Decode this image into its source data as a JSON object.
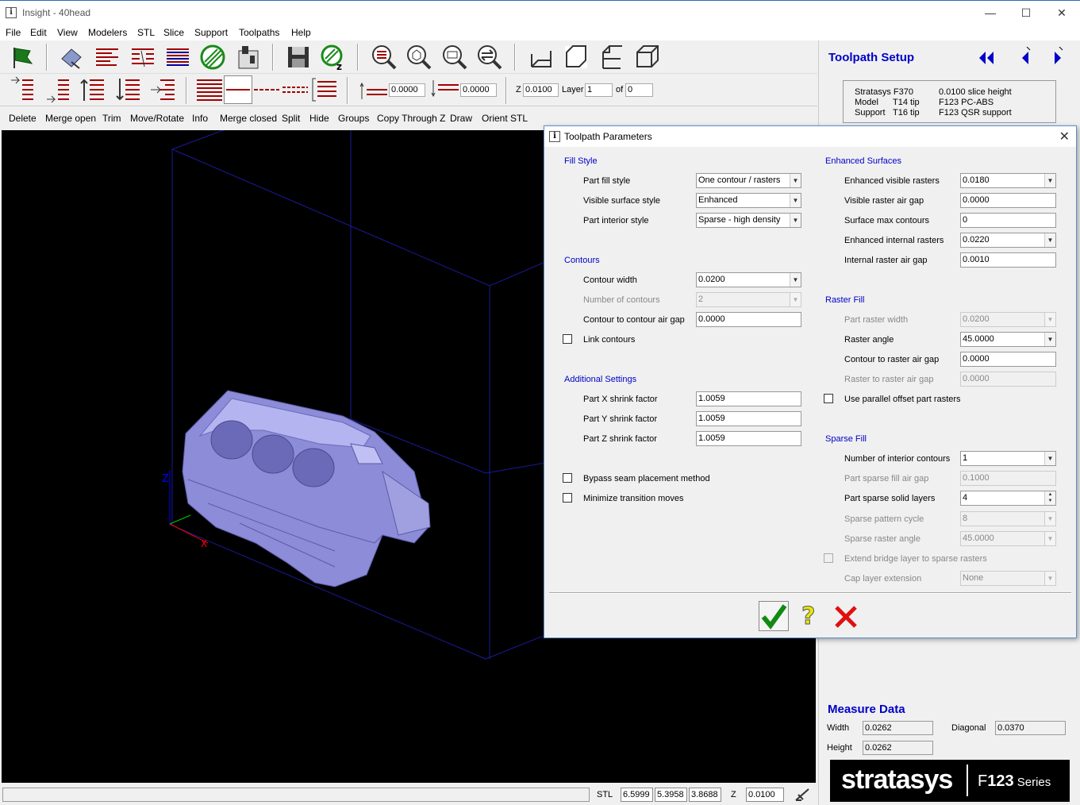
{
  "window": {
    "title": "Insight - 40head"
  },
  "menu": [
    "File",
    "Edit",
    "View",
    "Modelers",
    "STL",
    "Slice",
    "Support",
    "Toolpaths",
    "Help"
  ],
  "toolbar2": {
    "field1": "0.0000",
    "field2": "0.0000",
    "z_label": "Z",
    "z_value": "0.0100",
    "layer_label": "Layer",
    "layer_value": "1",
    "of_label": "of",
    "of_value": "0"
  },
  "commands": [
    "Delete",
    "Merge open",
    "Trim",
    "Move/Rotate",
    "Info",
    "Merge closed",
    "Split",
    "Hide",
    "Groups",
    "Copy Through Z",
    "Draw",
    "Orient STL"
  ],
  "right_panel": {
    "title": "Toolpath Setup",
    "machine": [
      [
        "Stratasys F370",
        "0.0100 slice height"
      ],
      [
        "Model",
        "T14 tip",
        "F123 PC-ABS"
      ],
      [
        "Support",
        "T16 tip",
        "F123 QSR support"
      ]
    ],
    "measure_title": "Measure Data",
    "width_label": "Width",
    "width": "0.0262",
    "height_label": "Height",
    "height": "0.0262",
    "diagonal_label": "Diagonal",
    "diagonal": "0.0370",
    "logo_main": "stratasys",
    "logo_sub1": "F",
    "logo_sub2": "123",
    "logo_sub3": " Series"
  },
  "status": {
    "stl_label": "STL",
    "x": "6.5999",
    "y": "5.3958",
    "zsize": "3.8688",
    "z_label": "Z",
    "z": "0.0100"
  },
  "viewport": {
    "axis_z": "Z",
    "axis_x": "X"
  },
  "dialog": {
    "title": "Toolpath Parameters",
    "fill_style": {
      "heading": "Fill Style",
      "part_fill_style_label": "Part fill style",
      "part_fill_style": "One contour / rasters",
      "visible_surface_style_label": "Visible surface style",
      "visible_surface_style": "Enhanced",
      "part_interior_style_label": "Part interior style",
      "part_interior_style": "Sparse - high density"
    },
    "contours": {
      "heading": "Contours",
      "contour_width_label": "Contour width",
      "contour_width": "0.0200",
      "number_of_contours_label": "Number of contours",
      "number_of_contours": "2",
      "contour_air_gap_label": "Contour to contour air gap",
      "contour_air_gap": "0.0000",
      "link_contours_label": "Link contours"
    },
    "additional": {
      "heading": "Additional Settings",
      "x_shrink_label": "Part X shrink factor",
      "x_shrink": "1.0059",
      "y_shrink_label": "Part Y shrink factor",
      "y_shrink": "1.0059",
      "z_shrink_label": "Part Z shrink factor",
      "z_shrink": "1.0059",
      "bypass_seam_label": "Bypass seam placement method",
      "minimize_transition_label": "Minimize transition moves"
    },
    "enhanced": {
      "heading": "Enhanced Surfaces",
      "visible_rasters_label": "Enhanced visible rasters",
      "visible_rasters": "0.0180",
      "visible_air_gap_label": "Visible raster air gap",
      "visible_air_gap": "0.0000",
      "surface_max_contours_label": "Surface max contours",
      "surface_max_contours": "0",
      "internal_rasters_label": "Enhanced internal rasters",
      "internal_rasters": "0.0220",
      "internal_air_gap_label": "Internal raster air gap",
      "internal_air_gap": "0.0010"
    },
    "raster": {
      "heading": "Raster Fill",
      "part_raster_width_label": "Part raster width",
      "part_raster_width": "0.0200",
      "raster_angle_label": "Raster angle",
      "raster_angle": "45.0000",
      "contour_raster_gap_label": "Contour to raster air gap",
      "contour_raster_gap": "0.0000",
      "raster_raster_gap_label": "Raster to raster air gap",
      "raster_raster_gap": "0.0000",
      "parallel_offset_label": "Use parallel offset part rasters"
    },
    "sparse": {
      "heading": "Sparse Fill",
      "interior_contours_label": "Number of interior contours",
      "interior_contours": "1",
      "sparse_air_gap_label": "Part sparse fill air gap",
      "sparse_air_gap": "0.1000",
      "solid_layers_label": "Part sparse solid layers",
      "solid_layers": "4",
      "pattern_cycle_label": "Sparse pattern cycle",
      "pattern_cycle": "8",
      "sparse_angle_label": "Sparse raster angle",
      "sparse_angle": "45.0000",
      "bridge_label": "Extend bridge layer to sparse rasters",
      "cap_label": "Cap layer extension",
      "cap": "None"
    },
    "help_glyph": "?"
  }
}
